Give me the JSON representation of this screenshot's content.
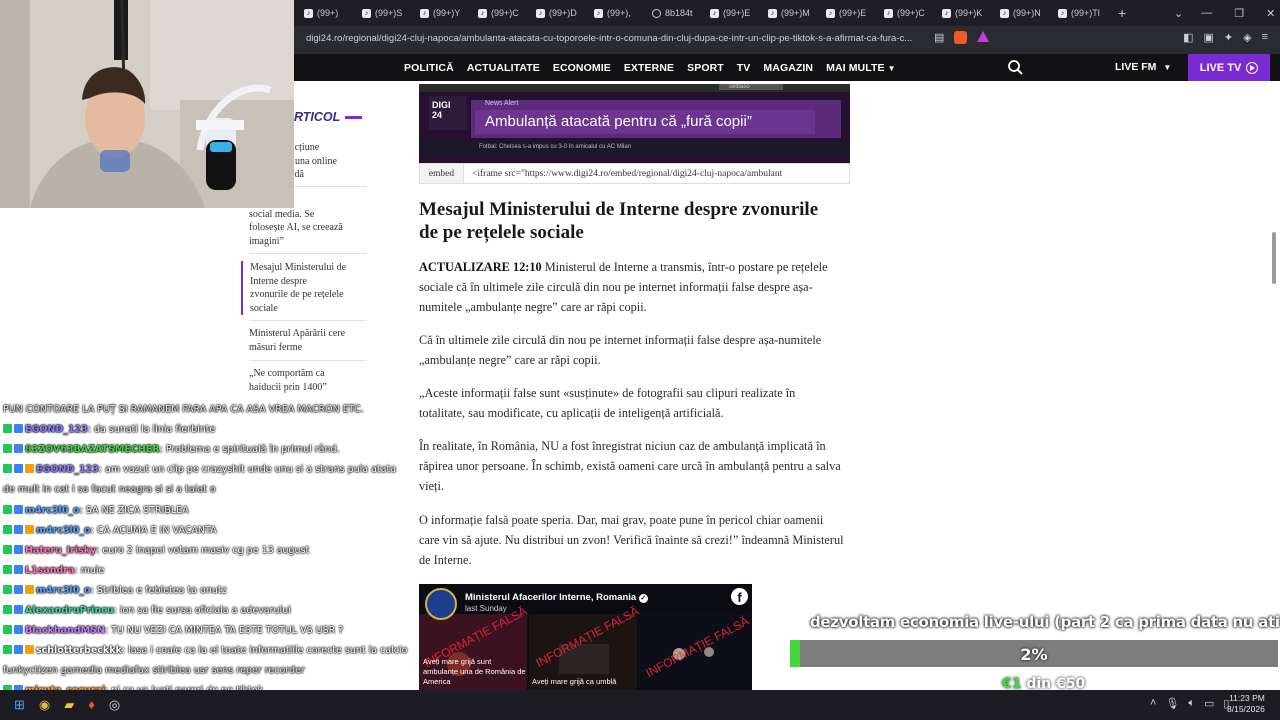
{
  "browser": {
    "tabs": [
      "(99+)",
      "(99+)S",
      "(99+)Y",
      "(99+)C",
      "(99+)D",
      "(99+),",
      "8b184t",
      "(99+)E",
      "(99+)M",
      "(99+)E",
      "(99+)C",
      "(99+)K",
      "(99+)N",
      "(99+)Tl"
    ],
    "url": "digi24.ro/regional/digi24-cluj-napoca/ambulanta-atacata-cu-toporoele-intr-o-comuna-din-cluj-dupa-ce-intr-un-clip-pe-tiktok-s-a-afirmat-ca-fura-c..."
  },
  "site_nav": {
    "items": [
      "POLITICĂ",
      "ACTUALITATE",
      "ECONOMIE",
      "EXTERNE",
      "SPORT",
      "TV",
      "MAGAZIN",
      "MAI MULTE"
    ],
    "live_fm": "LIVE FM",
    "live_tv": "LIVE TV"
  },
  "toc": {
    "title": "RTICOL",
    "items": [
      "re acțiune\ninciuna online\nstradă",
      "nă de pe\nsocial media. Se\nfolosește AI, se creează\nimagini”",
      "Mesajul Ministerului de\nInterne despre\nzvonurile de pe rețelele\nsociale",
      "Ministerul Apărării cere\nmăsuri ferme",
      "„Ne comportăm ca\nhaiducii prin 1400”"
    ]
  },
  "article": {
    "video": {
      "logo": "DIGI 24",
      "alert": "News Alert",
      "headline": "Ambulanță atacată pentru că „fură copii”",
      "ticker": "Fotbal: Chelsea s-a impus cu 3-0 în amicalul cu AC Milan",
      "corner": "selbaso"
    },
    "embed_label": "embed",
    "embed_code": "<iframe src=\"https://www.digi24.ro/embed/regional/digi24-cluj-napoca/ambulant",
    "heading": "Mesajul Ministerului de Interne despre zvonurile de pe rețelele sociale",
    "update_label": "ACTUALIZARE 12:10",
    "p1": " Ministerul de Interne a transmis, într-o postare pe rețelele sociale că în ultimele zile circulă din nou pe internet informații false despre așa-numitele „ambulanțe negre” care ar răpi copii.",
    "p2": "Că în ultimele zile circulă din nou pe internet informații false despre așa-numitele „ambulanțe negre” care ar răpi copii.",
    "p3": "„Aceste informații false sunt «susținute» de fotografii sau clipuri realizate în totalitate, sau modificate, cu aplicații de inteligență artificială.",
    "p4": "În realitate, în România, NU a fost înregistrat niciun caz de ambulanță implicată în răpirea unor persoane. În schimb, există oameni care urcă în ambulanță pentru a salva vieți.",
    "p5": "O informație falsă poate speria. Dar, mai grav, poate pune în pericol chiar oamenii care vin să ajute. Nu distribui un zvon! Verifică înainte să crezi!” îndeamnă Ministerul de Interne.",
    "fb_post": {
      "page": "Ministerul Afacerilor Interne, Romania",
      "time": "last Sunday",
      "stamp": "INFORMAȚIE FALSĂ",
      "caption1": "Aveți mare grijă sunt ambulanțe una de România de America",
      "caption2": "Aveți mare grijă ca umblă"
    }
  },
  "chat": [
    {
      "user": "",
      "text": "PUN CONTOARE LA PUȚ SI RAMANEM FARA APA CA ASA VREA MACRON ETC.",
      "color": "#ffffff"
    },
    {
      "user": "EGOND_123",
      "text": ": da sunati la linia fierbinte",
      "color": "#8a7cff"
    },
    {
      "user": "83ZOV63BAZATSMECHER",
      "text": ": Problema e spirituală în primul rând.",
      "color": "#3fd63f"
    },
    {
      "user": "EGOND_123",
      "text": ": am vazut un clip pe crazyshit unde unu si a strans pula atata",
      "color": "#8a7cff"
    },
    {
      "user": "",
      "text": "de mult in cat i sa facut neagra si si a taiat o",
      "color": "#ffffff"
    },
    {
      "user": "m4rc3l0_o",
      "text": ": SA NE ZICA STRIBLEA",
      "color": "#5aa0ff"
    },
    {
      "user": "m4rc3l0_o",
      "text": ": CA ACUMA E IN VACANTA",
      "color": "#5aa0ff"
    },
    {
      "user": "Hateru_Irisky",
      "text": ": euro 2 inapoi votam masiv cg pe 13 august",
      "color": "#ff6fb5"
    },
    {
      "user": "L1sandra",
      "text": ": mule",
      "color": "#ff6fb5"
    },
    {
      "user": "m4rc3l0_o",
      "text": ": Striblea e febletea ta onutz",
      "color": "#5aa0ff"
    },
    {
      "user": "AlexandruPrincu",
      "text": ": ion sa fie sursa oficiala a adevarului",
      "color": "#3fd6a0"
    },
    {
      "user": "BlackhandMSN",
      "text": ": TU NU VEZI CA MINTEA TA ESTE TOTUL VS USR ?",
      "color": "#c77dff"
    },
    {
      "user": "schlotterbeckkk",
      "text": ": lasa i coaie ca la ei toate informatiile corecte sunt la calcio",
      "color": "#ffffff"
    },
    {
      "user": "",
      "text": "funkyctizen gamedia mediafax stiriblea usr sens reper recorder",
      "color": "#ffffff"
    },
    {
      "user": "micuta_cecurai",
      "text": ": pi ca va luati pareri de pe tiktok",
      "color": "#ff9a3c"
    },
    {
      "user": "Hateru_Irisky",
      "text": ": bolojan are sa imi de a 2 k euro datorie",
      "color": "#ff6fb5"
    }
  ],
  "goal": {
    "title": "dezvoltam economia live-ului (part 2 ca prima data nu ati vrut)",
    "percent_text": "2%",
    "progress": 0.02,
    "raised": "€1",
    "sep": " din ",
    "target": "€50"
  },
  "taskbar": {
    "time": "11:23 PM",
    "date": "8/15/2026"
  },
  "colors": {
    "accent": "#7b2bd4",
    "goal_fill": "#44d63c"
  }
}
